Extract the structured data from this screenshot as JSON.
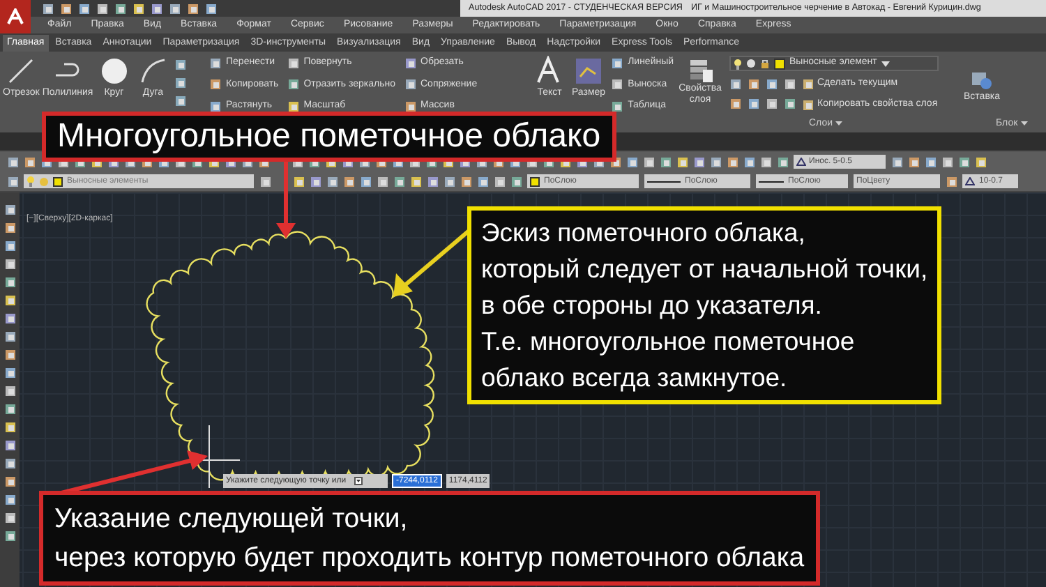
{
  "title_bar": {
    "title": "Autodesk AutoCAD 2017 - СТУДЕНЧЕСКАЯ ВЕРСИЯ",
    "filename": "ИГ и Машиностроительное черчение в Автокад - Евгений Курицин.dwg"
  },
  "menu": [
    "Файл",
    "Правка",
    "Вид",
    "Вставка",
    "Формат",
    "Сервис",
    "Рисование",
    "Размеры",
    "Редактировать",
    "Параметризация",
    "Окно",
    "Справка",
    "Express"
  ],
  "ribbon_tabs": [
    {
      "label": "Главная",
      "selected": true
    },
    {
      "label": "Вставка",
      "selected": false
    },
    {
      "label": "Аннотации",
      "selected": false
    },
    {
      "label": "Параметризация",
      "selected": false
    },
    {
      "label": "3D-инструменты",
      "selected": false
    },
    {
      "label": "Визуализация",
      "selected": false
    },
    {
      "label": "Вид",
      "selected": false
    },
    {
      "label": "Управление",
      "selected": false
    },
    {
      "label": "Вывод",
      "selected": false
    },
    {
      "label": "Надстройки",
      "selected": false
    },
    {
      "label": "Express Tools",
      "selected": false
    },
    {
      "label": "Performance",
      "selected": false
    }
  ],
  "ribbon": {
    "draw_tools": [
      "Отрезок",
      "Полилиния",
      "Круг",
      "Дуга"
    ],
    "modify_tools": [
      [
        "Перенести",
        "Копировать",
        "Растянуть"
      ],
      [
        "Повернуть",
        "Отразить зеркально",
        "Масштаб"
      ],
      [
        "Обрезать",
        "Сопряжение",
        "Массив"
      ]
    ],
    "annotation_big": [
      "Текст",
      "Размер"
    ],
    "annotation_small": [
      "Линейный",
      "Выноска",
      "Таблица"
    ],
    "layer_properties": "Свойства слоя",
    "layer_dropdown": "Выносные элемент",
    "layer_actions": [
      "Сделать текущим",
      "Копировать свойства слоя"
    ],
    "block_insert": "Вставка",
    "panel_labels": [
      "Слои",
      "Блок"
    ]
  },
  "toolbar": {
    "dim_style": "Инос. 5-0.5",
    "layer": "Выносные элементы",
    "color_setting": "ПоСлою",
    "linetype": "ПоСлою",
    "lineweight": "ПоСлою",
    "plot_style": "ПоЦвету",
    "text_style": "10-0.7"
  },
  "viewport": {
    "label": "[−][Сверху][2D-каркас]"
  },
  "command": {
    "prompt": "Укажите следующую точку или",
    "x_value": "-7244,0112",
    "y_value": "1174,4112"
  },
  "callouts": [
    {
      "kind": "title",
      "color": "#d42a2a",
      "lines": [
        "Многоугольное пометочное облако"
      ]
    },
    {
      "kind": "note",
      "color": "#f0e000",
      "lines": [
        "Эскиз пометочного облака,",
        "который следует от начальной точки,",
        "в обе стороны до указателя.",
        "Т.е. многоугольное пометочное",
        "облако всегда замкнутое."
      ]
    },
    {
      "kind": "bottom",
      "color": "#d42a2a",
      "lines": [
        "Указание следующей точки,",
        "через которую будет проходить контур пометочного облака"
      ]
    }
  ]
}
